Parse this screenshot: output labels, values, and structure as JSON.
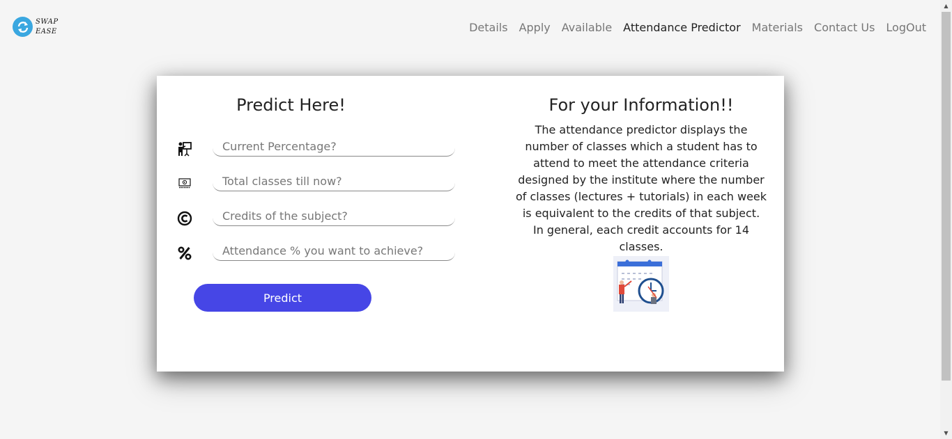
{
  "brand": {
    "line1": "SWAP",
    "line2": "EASE",
    "color": "#3aa7e0"
  },
  "nav": {
    "items": [
      {
        "label": "Details"
      },
      {
        "label": "Apply"
      },
      {
        "label": "Available"
      },
      {
        "label": "Attendance Predictor",
        "active": true
      },
      {
        "label": "Materials"
      },
      {
        "label": "Contact Us"
      },
      {
        "label": "LogOut"
      }
    ]
  },
  "predict": {
    "title": "Predict Here!",
    "fields": [
      {
        "placeholder": "Current Percentage?",
        "value": "",
        "icon": "teacher-icon"
      },
      {
        "placeholder": "Total classes till now?",
        "value": "",
        "icon": "tutorial-icon"
      },
      {
        "placeholder": "Credits of the subject?",
        "value": "",
        "icon": "copyright-icon"
      },
      {
        "placeholder": "Attendance % you want to achieve?",
        "value": "",
        "icon": "percent-icon"
      }
    ],
    "button_label": "Predict",
    "button_color": "#4646e6"
  },
  "info": {
    "title": "For your Information!!",
    "text": "The attendance predictor displays the number of classes which a student has to attend to meet the attendance criteria designed by the institute where the number of classes (lectures + tutorials) in each week is equivalent to the credits of that subject. In general, each credit accounts for 14 classes.",
    "image": "calendar-clock-illustration"
  }
}
